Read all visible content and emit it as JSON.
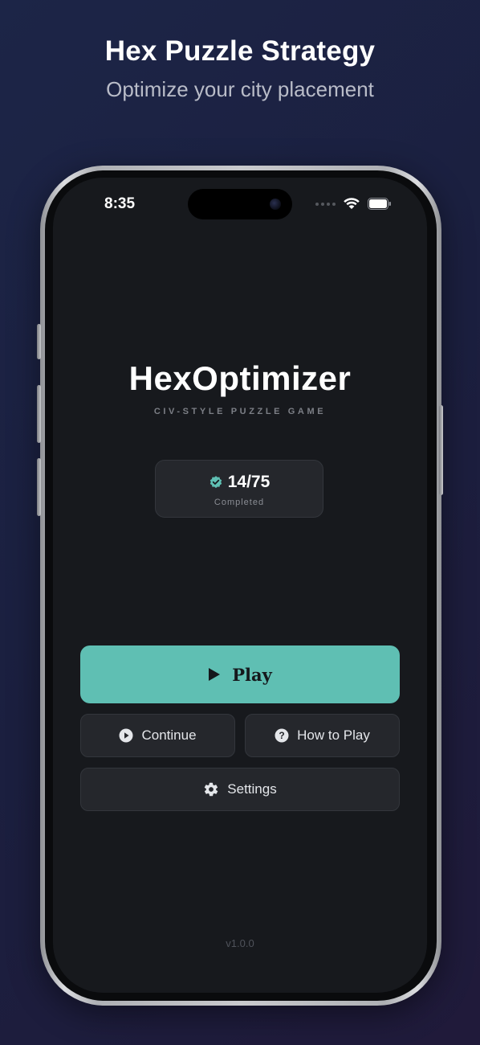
{
  "promo": {
    "title": "Hex Puzzle Strategy",
    "subtitle": "Optimize your city placement"
  },
  "status_bar": {
    "time": "8:35",
    "icons": [
      "signal-dots-icon",
      "wifi-icon",
      "battery-icon"
    ]
  },
  "app": {
    "name": "HexOptimizer",
    "tagline": "CIV-STYLE PUZZLE GAME",
    "version": "v1.0.0"
  },
  "progress": {
    "count": "14/75",
    "label": "Completed",
    "icon": "verified-check-icon",
    "accent_color": "#5fbfb3"
  },
  "buttons": {
    "play": "Play",
    "continue": "Continue",
    "how_to_play": "How to Play",
    "settings": "Settings"
  },
  "colors": {
    "accent": "#5fbfb3",
    "screen_background": "#17191d",
    "card_background": "#25272c"
  }
}
